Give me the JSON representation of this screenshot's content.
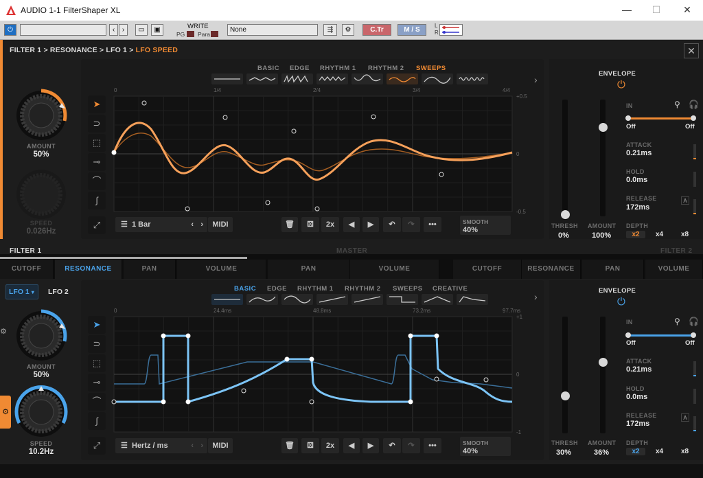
{
  "window": {
    "title": "AUDIO 1-1 FilterShaper XL",
    "minimize": "—",
    "maximize": "☐",
    "close": "✕"
  },
  "toolbar": {
    "preset": "",
    "write": "WRITE",
    "pg": "PG",
    "para": "Para",
    "automation": "None",
    "ctr": "C.Tr",
    "ms": "M / S",
    "l": "L",
    "r": "R"
  },
  "top": {
    "breadcrumb_pre": "FILTER 1 > RESONANCE > LFO 1 > ",
    "breadcrumb_hl": "LFO SPEED",
    "tabs": [
      "BASIC",
      "EDGE",
      "RHYTHM 1",
      "RHYTHM 2",
      "SWEEPS"
    ],
    "active_tab": "SWEEPS",
    "ruler": [
      "0",
      "1/4",
      "2/4",
      "3/4",
      "4/4"
    ],
    "yaxis": [
      "+0.5",
      "0",
      "-0.5"
    ],
    "amount_label": "AMOUNT",
    "amount_value": "50%",
    "speed_label": "SPEED",
    "speed_value": "0.026Hz",
    "sync": "1 Bar",
    "midi": "MIDI",
    "mult": "2x",
    "smooth_label": "SMOOTH",
    "smooth_value": "40%",
    "envelope": "ENVELOPE",
    "in": "IN",
    "in_off1": "Off",
    "in_off2": "Off",
    "attack_label": "ATTACK",
    "attack": "0.21ms",
    "hold_label": "HOLD",
    "hold": "0.0ms",
    "release_label": "RELEASE",
    "release": "172ms",
    "a": "A",
    "thresh_label": "THRESH",
    "thresh": "0%",
    "amount2_label": "AMOUNT",
    "amount2": "100%",
    "depth_label": "DEPTH",
    "depth": [
      "x2",
      "x4",
      "x8"
    ],
    "accent": "#f08a33"
  },
  "mid": {
    "filter1": "FILTER 1",
    "master": "MASTER",
    "filter2": "FILTER 2",
    "tabs": [
      "CUTOFF",
      "RESONANCE",
      "PAN",
      "VOLUME",
      "PAN",
      "VOLUME",
      "CUTOFF",
      "RESONANCE",
      "PAN",
      "VOLUME"
    ],
    "active": "RESONANCE"
  },
  "bottom": {
    "lfo1": "LFO 1",
    "lfo2": "LFO 2",
    "tabs": [
      "BASIC",
      "EDGE",
      "RHYTHM 1",
      "RHYTHM 2",
      "SWEEPS",
      "CREATIVE"
    ],
    "active_tab": "BASIC",
    "ruler": [
      "0",
      "24.4ms",
      "48.8ms",
      "73.2ms",
      "97.7ms"
    ],
    "yaxis": [
      "+1",
      "0",
      "-1"
    ],
    "amount_label": "AMOUNT",
    "amount_value": "50%",
    "speed_label": "SPEED",
    "speed_value": "10.2Hz",
    "sync": "Hertz / ms",
    "midi": "MIDI",
    "mult": "2x",
    "smooth_label": "SMOOTH",
    "smooth_value": "40%",
    "envelope": "ENVELOPE",
    "in": "IN",
    "in_off1": "Off",
    "in_off2": "Off",
    "attack_label": "ATTACK",
    "attack": "0.21ms",
    "hold_label": "HOLD",
    "hold": "0.0ms",
    "release_label": "RELEASE",
    "release": "172ms",
    "a": "A",
    "thresh_label": "THRESH",
    "thresh": "30%",
    "amount2_label": "AMOUNT",
    "amount2": "36%",
    "depth_label": "DEPTH",
    "depth": [
      "x2",
      "x4",
      "x8"
    ],
    "accent": "#4aa3ea"
  }
}
